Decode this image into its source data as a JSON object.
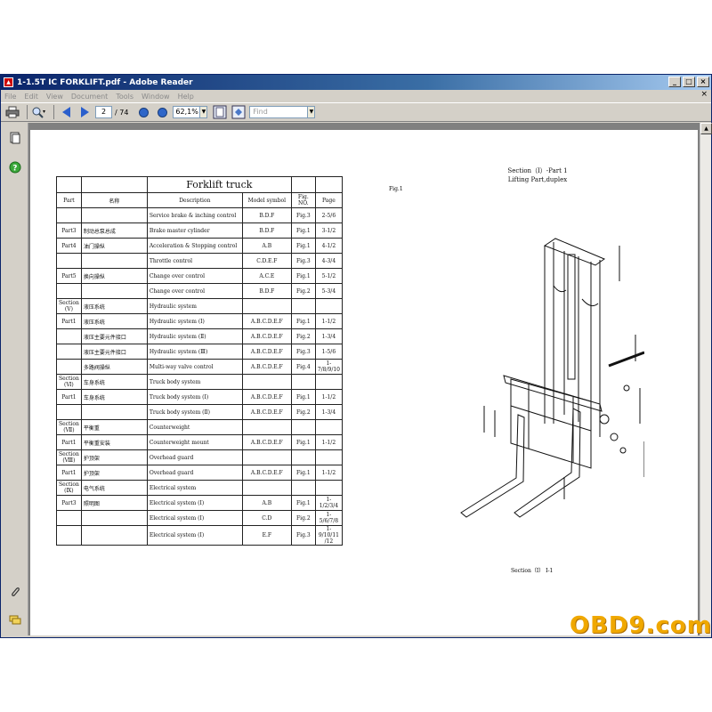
{
  "window": {
    "title": "1-1.5T IC FORKLIFT.pdf - Adobe Reader",
    "controls": [
      "_",
      "□",
      "×"
    ]
  },
  "menu": [
    "File",
    "Edit",
    "View",
    "Document",
    "Tools",
    "Window",
    "Help"
  ],
  "toolbar": {
    "current_page": "2",
    "total_pages": "/ 74",
    "zoom": "62,1%",
    "find_placeholder": "Find"
  },
  "doc": {
    "table_title": "Forklift truck",
    "headers": [
      "Part",
      "名称",
      "Description",
      "Model symbol",
      "Fig. NO.",
      "Page"
    ],
    "rows": [
      [
        "",
        "",
        "Service brake & inching control",
        "B.D.F",
        "Fig.3",
        "2-5/6"
      ],
      [
        "Part3",
        "制动总泵总成",
        "Brake master cylinder",
        "B.D.F",
        "Fig.1",
        "3-1/2"
      ],
      [
        "Part4",
        "油门操纵",
        "Acceleration & Stopping control",
        "A.B",
        "Fig.1",
        "4-1/2"
      ],
      [
        "",
        "",
        "Throttle control",
        "C.D.E.F",
        "Fig.3",
        "4-3/4"
      ],
      [
        "Part5",
        "换向操纵",
        "Change over control",
        "A.C.E",
        "Fig.1",
        "5-1/2"
      ],
      [
        "",
        "",
        "Change over control",
        "B.D.F",
        "Fig.2",
        "5-3/4"
      ],
      [
        "Section (Ⅴ)",
        "液压系统",
        "Hydraulic system",
        "",
        "",
        ""
      ],
      [
        "Part1",
        "液压系统",
        "Hydraulic system (Ⅰ)",
        "A.B.C.D.E.F",
        "Fig.1",
        "1-1/2"
      ],
      [
        "",
        "液压主要元件接口",
        "Hydraulic system (Ⅱ)",
        "A.B.C.D.E.F",
        "Fig.2",
        "1-3/4"
      ],
      [
        "",
        "液压主要元件接口",
        "Hydraulic system (Ⅲ)",
        "A.B.C.D.E.F",
        "Fig.3",
        "1-5/6"
      ],
      [
        "",
        "多路阀操纵",
        "Multi-way valve control",
        "A.B.C.D.E.F",
        "Fig.4",
        "1-7/8/9/10"
      ],
      [
        "Section (Ⅵ)",
        "车身系统",
        "Truck body system",
        "",
        "",
        ""
      ],
      [
        "Part1",
        "车身系统",
        "Truck body system (Ⅰ)",
        "A.B.C.D.E.F",
        "Fig.1",
        "1-1/2"
      ],
      [
        "",
        "",
        "Truck body system (Ⅱ)",
        "A.B.C.D.E.F",
        "Fig.2",
        "1-3/4"
      ],
      [
        "Section (Ⅶ)",
        "平衡重",
        "Counterweight",
        "",
        "",
        ""
      ],
      [
        "Part1",
        "平衡重安装",
        "Counterweight mount",
        "A.B.C.D.E.F",
        "Fig.1",
        "1-1/2"
      ],
      [
        "Section (Ⅷ)",
        "护顶架",
        "Overhead guard",
        "",
        "",
        ""
      ],
      [
        "Part1",
        "护顶架",
        "Overhead guard",
        "A.B.C.D.E.F",
        "Fig.1",
        "1-1/2"
      ],
      [
        "Section (Ⅸ)",
        "电气系统",
        "Electrical system",
        "",
        "",
        ""
      ],
      [
        "Part3",
        "照明图",
        "Electrical system (I)",
        "A.B",
        "Fig.1",
        "1-1/2/3/4"
      ],
      [
        "",
        "",
        "Electrical system (I)",
        "C.D",
        "Fig.2",
        "1-5/6/7/8"
      ],
      [
        "",
        "",
        "Electrical system (I)",
        "E.F",
        "Fig.3",
        "1-9/10/11 /12"
      ]
    ],
    "right_title_1": "Section（Ⅰ）-Part 1",
    "right_title_2": "Lifting Part,duplex",
    "fig_label": "Fig.1",
    "footer": "Section（Ⅰ）   Ⅰ-1"
  },
  "watermark": "OBD9.com",
  "icons": {
    "print": "printer-icon",
    "search": "search-icon",
    "prev": "arrow-left-icon",
    "next": "arrow-right-icon",
    "zoom_out": "zoom-out-icon",
    "zoom_in": "zoom-in-icon",
    "pages": "pages-icon",
    "help": "help-icon",
    "attach": "paperclip-icon",
    "comment": "comment-icon"
  }
}
